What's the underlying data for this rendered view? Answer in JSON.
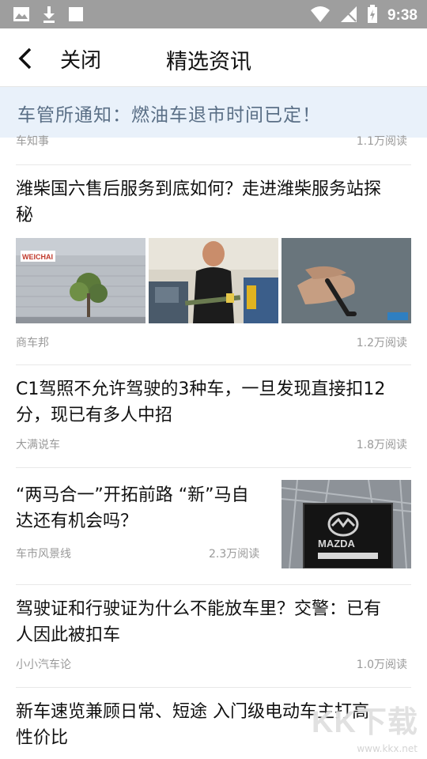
{
  "status": {
    "time": "9:38"
  },
  "header": {
    "close_label": "关闭",
    "title": "精选资讯"
  },
  "notice": {
    "text": "车管所通知：燃油车退市时间已定！"
  },
  "partial_item": {
    "source": "车知事",
    "reads": "1.1万阅读"
  },
  "articles": [
    {
      "title_line1": "潍柴国六售后服务到底如何？走进潍柴服务站探",
      "title_line2": "秘",
      "source": "商车邦",
      "reads": "1.2万阅读"
    },
    {
      "title_line1": "C1驾照不允许驾驶的3种车，一旦发现直接扣12",
      "title_line2": "分，现已有多人中招",
      "source": "大满说车",
      "reads": "1.8万阅读"
    },
    {
      "title_line1": "“两马合一”开拓前路 “新”马自",
      "title_line2": "达还有机会吗？",
      "source": "车市风景线",
      "reads": "2.3万阅读"
    },
    {
      "title_line1": "驾驶证和行驶证为什么不能放车里？交警：已有",
      "title_line2": "人因此被扣车",
      "source": "小小汽车论",
      "reads": "1.0万阅读"
    },
    {
      "title_line1": "新车速览兼顾日常、短途 入门级电动车主打高",
      "title_line2": "性价比"
    }
  ],
  "thumb_text": {
    "weichai_logo": "WEICHAI",
    "mazda_sign": "MAZDA"
  },
  "watermark": {
    "text": "KK下载",
    "url": "www.kkx.net"
  }
}
